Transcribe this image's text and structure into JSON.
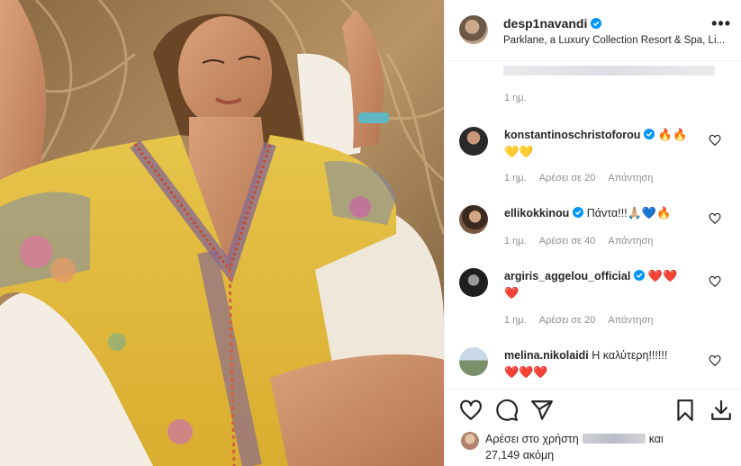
{
  "header": {
    "username": "desp1navandi",
    "location": "Parklane, a Luxury Collection Resort & Spa, Li...",
    "caption_time": "1 ημ."
  },
  "comments": [
    {
      "username": "konstantinoschristoforou",
      "text": "",
      "line1_emoji": "🔥🔥",
      "line2_emoji": "💛💛",
      "time": "1 ημ.",
      "likes": "Αρέσει σε 20",
      "reply": "Απάντηση"
    },
    {
      "username": "ellikokkinou",
      "text": "Πάντα!!!",
      "line1_emoji": "🙏🏼💙🔥",
      "line2_emoji": "",
      "time": "1 ημ.",
      "likes": "Αρέσει σε 40",
      "reply": "Απάντηση"
    },
    {
      "username": "argiris_aggelou_official",
      "text": "",
      "line1_emoji": "❤️❤️",
      "line2_emoji": "❤️",
      "time": "1 ημ.",
      "likes": "Αρέσει σε 20",
      "reply": "Απάντηση"
    },
    {
      "username": "melina.nikolaidi",
      "text": "Η καλύτερη!!!!!!",
      "line1_emoji": "",
      "line2_emoji": "❤️❤️❤️",
      "time": "",
      "likes": "",
      "reply": ""
    }
  ],
  "likes": {
    "prefix": "Αρέσει στο χρήστη",
    "suffix": "και",
    "count_line": "27,149 ακόμη"
  },
  "icons": [
    "verified-badge-icon",
    "more-options-icon",
    "heart-icon",
    "comment-icon",
    "share-icon",
    "bookmark-icon",
    "download-icon"
  ],
  "colors": {
    "verified": "#0095f6",
    "muted": "#8e8e8e",
    "text": "#262626",
    "heart_red": "#ed4956"
  }
}
